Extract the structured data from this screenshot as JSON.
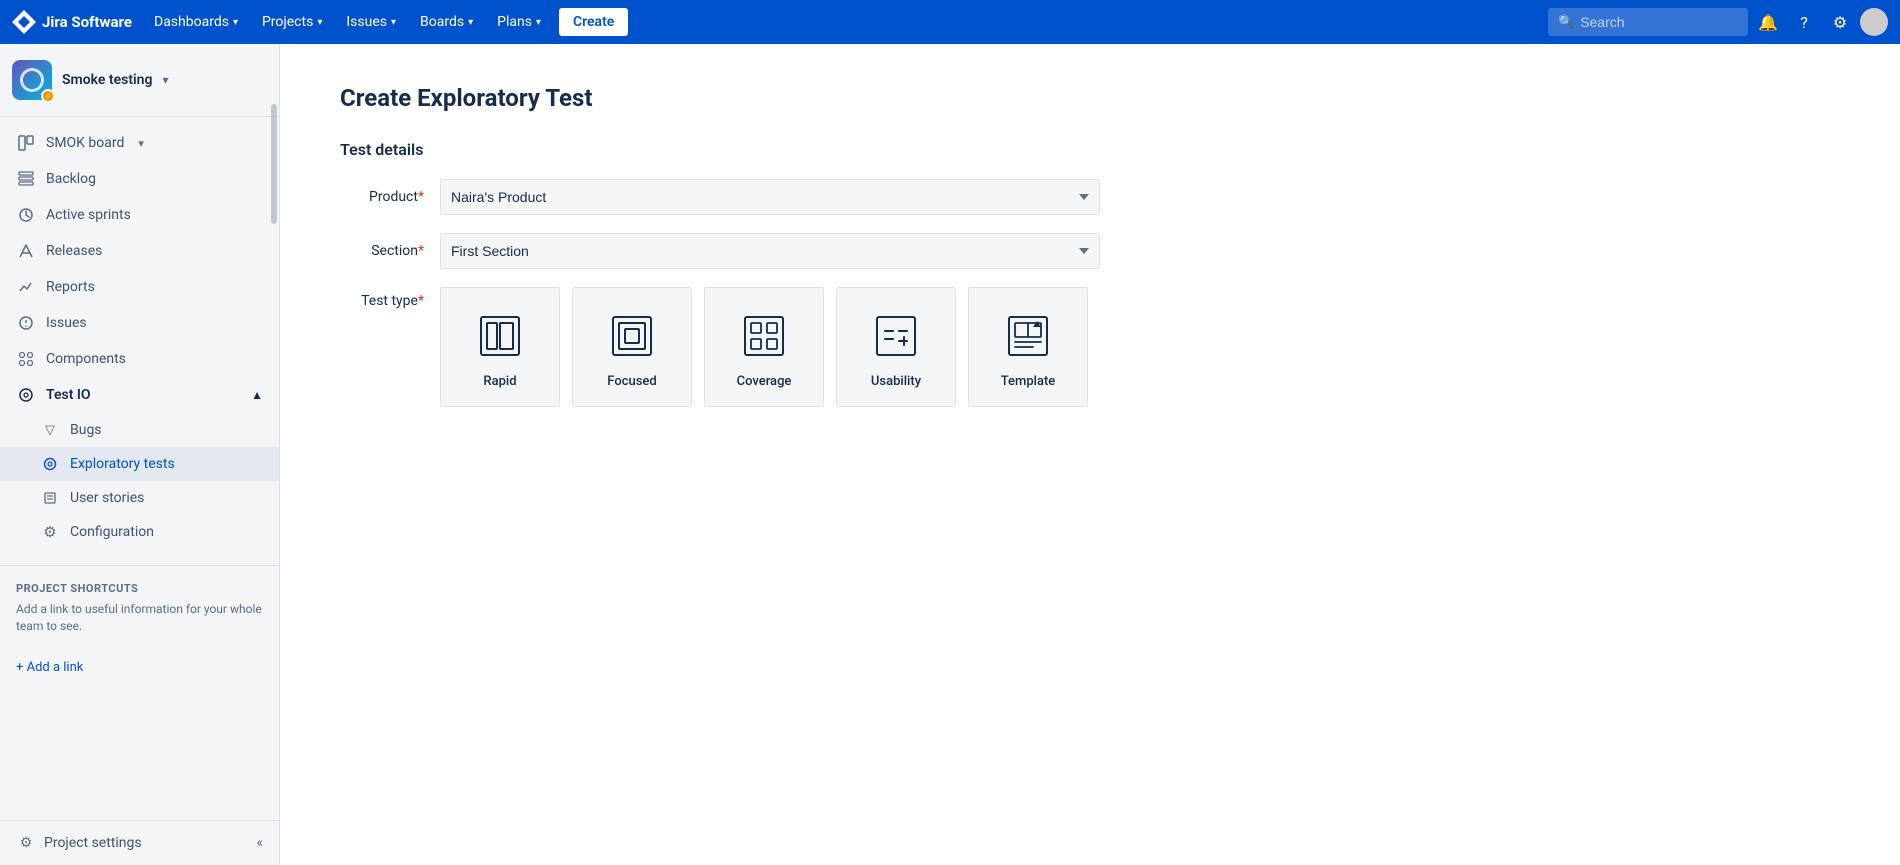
{
  "topnav": {
    "logo_text": "Jira Software",
    "nav_items": [
      {
        "label": "Dashboards",
        "has_chevron": true
      },
      {
        "label": "Projects",
        "has_chevron": true
      },
      {
        "label": "Issues",
        "has_chevron": true
      },
      {
        "label": "Boards",
        "has_chevron": true
      },
      {
        "label": "Plans",
        "has_chevron": true
      }
    ],
    "create_label": "Create",
    "search_placeholder": "Search"
  },
  "sidebar": {
    "project_name": "Smoke testing",
    "nav_items": [
      {
        "label": "SMOK board",
        "icon": "board-icon",
        "has_chevron": true
      },
      {
        "label": "Backlog",
        "icon": "backlog-icon"
      },
      {
        "label": "Active sprints",
        "icon": "sprints-icon"
      },
      {
        "label": "Releases",
        "icon": "releases-icon"
      },
      {
        "label": "Reports",
        "icon": "reports-icon"
      },
      {
        "label": "Issues",
        "icon": "issues-icon"
      },
      {
        "label": "Components",
        "icon": "components-icon"
      }
    ],
    "test_io_section": {
      "label": "Test IO",
      "items": [
        {
          "label": "Bugs",
          "icon": "bugs-icon"
        },
        {
          "label": "Exploratory tests",
          "icon": "exploratory-icon",
          "active": true
        },
        {
          "label": "User stories",
          "icon": "stories-icon"
        },
        {
          "label": "Configuration",
          "icon": "config-icon"
        }
      ]
    },
    "shortcuts_title": "PROJECT SHORTCUTS",
    "shortcuts_desc": "Add a link to useful information for your whole team to see.",
    "footer_label": "Project settings",
    "footer_icon": "settings-icon",
    "collapse_icon": "collapse-icon"
  },
  "main": {
    "page_title": "Create Exploratory Test",
    "section_title": "Test details",
    "product_label": "Product",
    "product_required": "*",
    "product_value": "Naira's Product",
    "product_options": [
      "Naira's Product"
    ],
    "section_label": "Section",
    "section_required": "*",
    "section_value": "First Section",
    "section_options": [
      "First Section"
    ],
    "test_type_label": "Test type",
    "test_type_required": "*",
    "test_types": [
      {
        "id": "rapid",
        "label": "Rapid"
      },
      {
        "id": "focused",
        "label": "Focused"
      },
      {
        "id": "coverage",
        "label": "Coverage"
      },
      {
        "id": "usability",
        "label": "Usability"
      },
      {
        "id": "template",
        "label": "Template"
      }
    ]
  }
}
